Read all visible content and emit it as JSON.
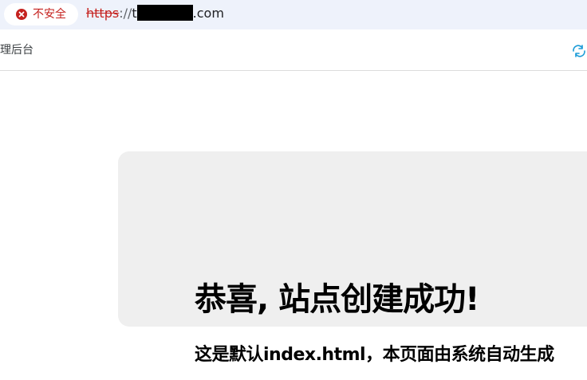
{
  "address_bar": {
    "security_label": "不安全",
    "url_scheme": "https",
    "url_separator": "://",
    "url_host_start": "t",
    "url_host_end": ".com"
  },
  "bookmarks": {
    "items": [
      {
        "label": "理后台"
      }
    ]
  },
  "page": {
    "heading": "恭喜, 站点创建成功!",
    "subheading": "这是默认index.html，本页面由系统自动生成"
  },
  "colors": {
    "insecure_red": "#c5221f",
    "address_bar_bg": "#eef2fb",
    "panel_bg": "#efefef",
    "refresh_icon": "#1a9bd7"
  },
  "icons": {
    "security": "warning-circle-icon",
    "refresh": "refresh-icon"
  }
}
